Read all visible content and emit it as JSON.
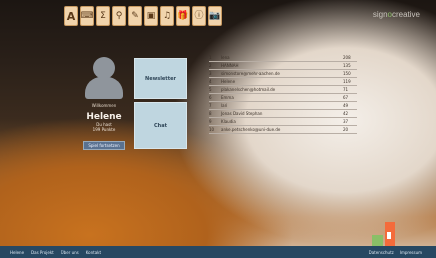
{
  "toolbar": {
    "icons": [
      {
        "name": "font-icon",
        "glyph": "A"
      },
      {
        "name": "calculator-icon",
        "glyph": "⌨"
      },
      {
        "name": "formula-icon",
        "glyph": "Σ"
      },
      {
        "name": "pin-icon",
        "glyph": "⚲"
      },
      {
        "name": "brush-icon",
        "glyph": "✎"
      },
      {
        "name": "stamp-icon",
        "glyph": "▣"
      },
      {
        "name": "music-icon",
        "glyph": "♫"
      },
      {
        "name": "gift-icon",
        "glyph": "🎁"
      },
      {
        "name": "info-icon",
        "glyph": "ⓘ"
      },
      {
        "name": "camera-icon",
        "glyph": "📷"
      }
    ]
  },
  "brand": {
    "prefix": "sign",
    "accent": "o",
    "suffix": "creative"
  },
  "profile": {
    "caption": "Willkommen",
    "name": "Helene",
    "level": "Du hast",
    "points": "199 Punkte",
    "button": "Spiel fortsetzen"
  },
  "tiles": {
    "newsletter": "Newsletter",
    "chat": "Chat"
  },
  "ranking": {
    "rows": [
      {
        "rank": "1",
        "name": "lena",
        "score": "208"
      },
      {
        "rank": "2",
        "name": "HANNAH",
        "score": "135"
      },
      {
        "rank": "3",
        "name": "simonstore@mehr-aachen.de",
        "score": "150"
      },
      {
        "rank": "4",
        "name": "Helene",
        "score": "119"
      },
      {
        "rank": "5",
        "name": "plakanelschen@hotmail.de",
        "score": "71"
      },
      {
        "rank": "6",
        "name": "Emma",
        "score": "67"
      },
      {
        "rank": "7",
        "name": "lari",
        "score": "49"
      },
      {
        "rank": "8",
        "name": "Jonas David Stephan",
        "score": "42"
      },
      {
        "rank": "9",
        "name": "Klaudia",
        "score": "37"
      },
      {
        "rank": "10",
        "name": "anke.petschenko@uni-due.de",
        "score": "20"
      }
    ]
  },
  "footer": {
    "links": [
      "Helene",
      "Das Projekt",
      "Über uns",
      "Kontakt"
    ],
    "right": [
      "Datenschutz",
      "Impressum"
    ]
  }
}
